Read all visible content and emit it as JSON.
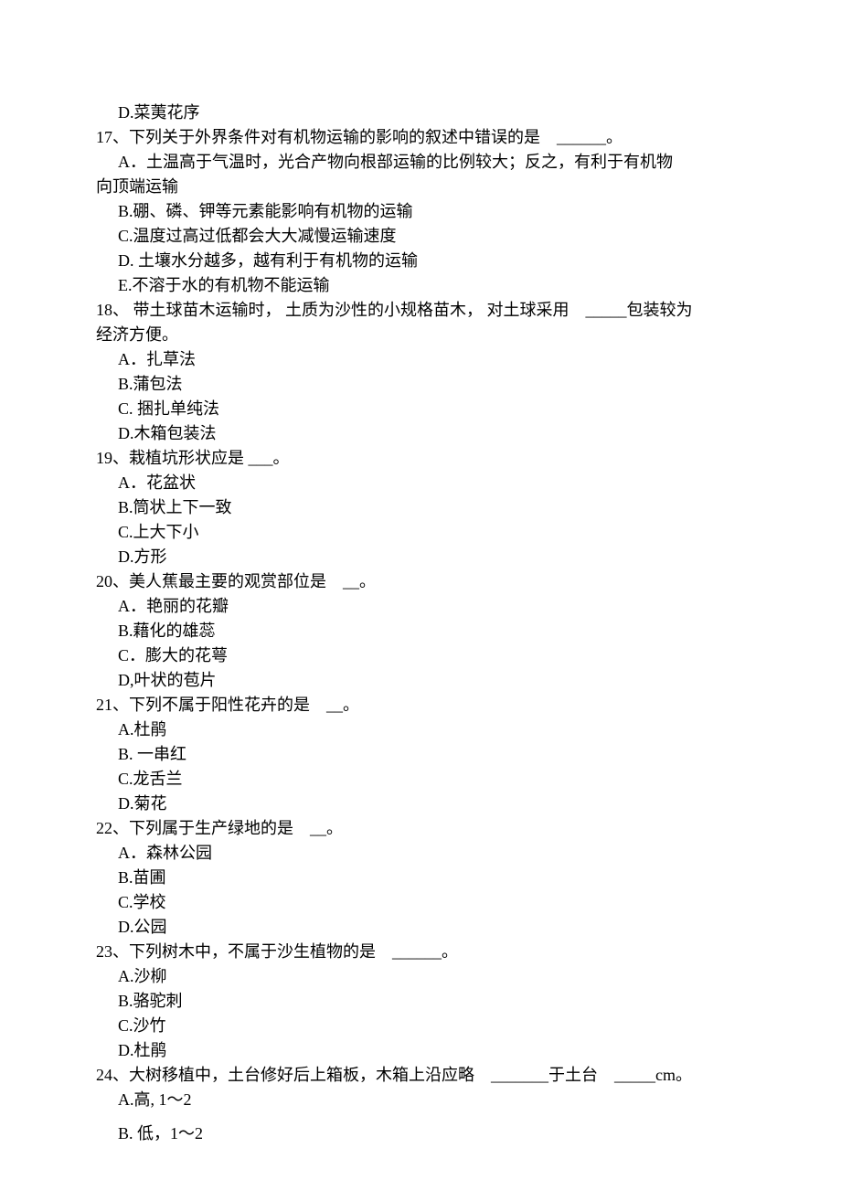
{
  "lines": [
    {
      "cls": "option",
      "text": "D.菜荑花序"
    },
    {
      "cls": "question",
      "text": "17、下列关于外界条件对有机物运输的影响的叙述中错误的是　______。"
    },
    {
      "cls": "option",
      "text": "A．土温高于气温时，光合产物向根部运输的比例较大；反之，有利于有机物"
    },
    {
      "cls": "question",
      "text": "向顶端运输"
    },
    {
      "cls": "option",
      "text": "B.硼、磷、钾等元素能影响有机物的运输"
    },
    {
      "cls": "option",
      "text": "C.温度过高过低都会大大减慢运输速度"
    },
    {
      "cls": "option",
      "text": "D. 土壤水分越多，越有利于有机物的运输"
    },
    {
      "cls": "option",
      "text": "E.不溶于水的有机物不能运输"
    },
    {
      "cls": "question",
      "text": "18、 带土球苗木运输时， 土质为沙性的小规格苗木， 对土球采用　_____包装较为"
    },
    {
      "cls": "question",
      "text": "经济方便。"
    },
    {
      "cls": "option",
      "text": "A．扎草法"
    },
    {
      "cls": "option",
      "text": "B.蒲包法"
    },
    {
      "cls": "option",
      "text": "C. 捆扎单纯法"
    },
    {
      "cls": "option",
      "text": "D.木箱包装法"
    },
    {
      "cls": "question",
      "text": "19、栽植坑形状应是 ___。"
    },
    {
      "cls": "option",
      "text": "A．花盆状"
    },
    {
      "cls": "option",
      "text": "B.筒状上下一致"
    },
    {
      "cls": "option",
      "text": "C.上大下小"
    },
    {
      "cls": "option",
      "text": "D.方形"
    },
    {
      "cls": "question",
      "text": "20、美人蕉最主要的观赏部位是　__。"
    },
    {
      "cls": "option",
      "text": "A．艳丽的花瓣"
    },
    {
      "cls": "option",
      "text": "B.藉化的雄蕊"
    },
    {
      "cls": "option",
      "text": "C．膨大的花萼"
    },
    {
      "cls": "option",
      "text": "D,叶状的苞片"
    },
    {
      "cls": "question",
      "text": "21、下列不属于阳性花卉的是　__。"
    },
    {
      "cls": "option",
      "text": "A.杜鹃"
    },
    {
      "cls": "option",
      "text": "B. 一串红"
    },
    {
      "cls": "option",
      "text": "C.龙舌兰"
    },
    {
      "cls": "option",
      "text": "D.菊花"
    },
    {
      "cls": "question",
      "text": "22、下列属于生产绿地的是　__。"
    },
    {
      "cls": "option",
      "text": "A．森林公园"
    },
    {
      "cls": "option",
      "text": "B.苗圃"
    },
    {
      "cls": "option",
      "text": "C.学校"
    },
    {
      "cls": "option",
      "text": "D.公园"
    },
    {
      "cls": "question",
      "text": "23、下列树木中，不属于沙生植物的是　______。"
    },
    {
      "cls": "option",
      "text": "A.沙柳"
    },
    {
      "cls": "option",
      "text": "B.骆驼刺"
    },
    {
      "cls": "option",
      "text": "C.沙竹"
    },
    {
      "cls": "option",
      "text": "D.杜鹃"
    },
    {
      "cls": "question",
      "text": "24、大树移植中，土台修好后上箱板，木箱上沿应略　_______于土台　_____cm。"
    },
    {
      "cls": "option",
      "text": "A.高, 1〜2"
    },
    {
      "cls": "option spaced",
      "text": "B. 低，1〜2"
    }
  ]
}
